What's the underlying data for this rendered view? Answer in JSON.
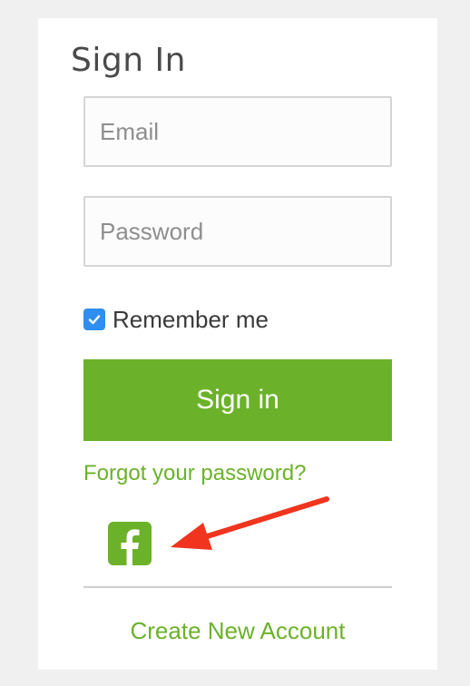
{
  "signin": {
    "title": "Sign In",
    "email_placeholder": "Email",
    "password_placeholder": "Password",
    "remember_label": "Remember me",
    "remember_checked": true,
    "submit_label": "Sign in",
    "forgot_label": "Forgot your password?",
    "social_icon": "facebook-icon",
    "create_label": "Create New Account"
  },
  "colors": {
    "accent": "#6bb22a",
    "checkbox": "#2f8ff0",
    "arrow": "#f0341e",
    "background": "#f0f0f0"
  }
}
